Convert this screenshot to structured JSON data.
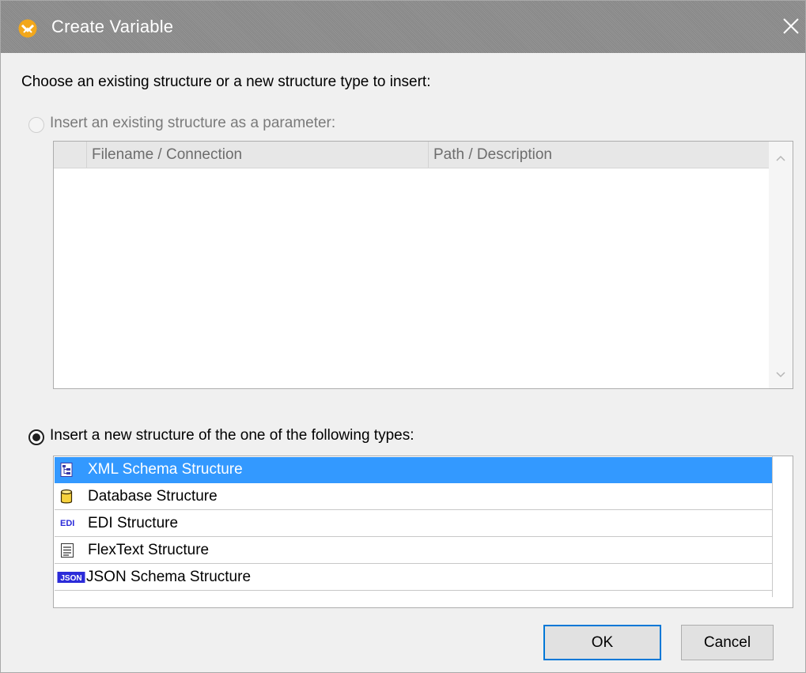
{
  "window": {
    "title": "Create Variable",
    "close_glyph": "✕",
    "app_icon": "mapforce-logo-icon"
  },
  "prompt": "Choose an existing structure or a new structure type to insert:",
  "option_existing": {
    "label": "Insert an existing structure as a parameter:",
    "checked": false,
    "enabled": false,
    "table": {
      "columns": [
        "Filename / Connection",
        "Path / Description"
      ],
      "rows": []
    }
  },
  "option_new": {
    "label": "Insert a new structure of the one of the following types:",
    "checked": true,
    "enabled": true,
    "types": [
      {
        "label": "XML Schema Structure",
        "icon": "xml-schema-icon",
        "selected": true
      },
      {
        "label": "Database Structure",
        "icon": "database-icon",
        "selected": false
      },
      {
        "label": "EDI Structure",
        "icon": "edi-icon",
        "selected": false
      },
      {
        "label": "FlexText Structure",
        "icon": "flextext-icon",
        "selected": false
      },
      {
        "label": "JSON Schema Structure",
        "icon": "json-schema-icon",
        "selected": false
      }
    ]
  },
  "buttons": {
    "ok": "OK",
    "cancel": "Cancel"
  },
  "colors": {
    "selection": "#3399ff",
    "titlebar": "#8e8e8e",
    "default_button_border": "#0078d7"
  },
  "icon_text": {
    "edi": "EDI",
    "json": "JSON"
  }
}
